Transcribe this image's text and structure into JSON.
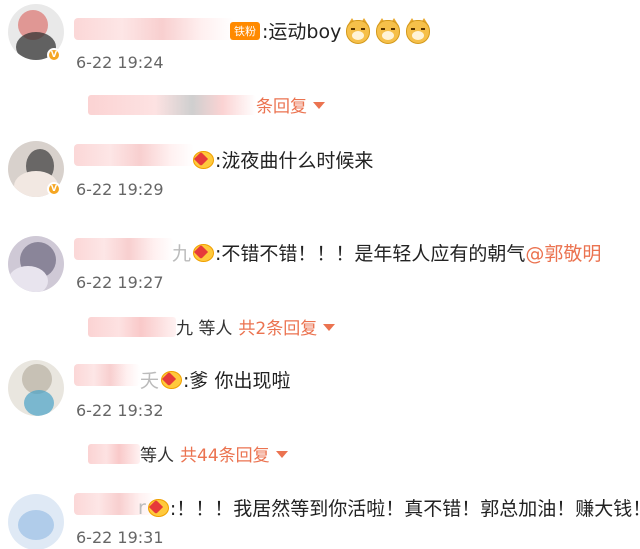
{
  "comments": [
    {
      "fan_badge": "铁粉",
      "text": ":运动boy",
      "emojis": [
        "doge-emoji",
        "doge-emoji",
        "doge-emoji"
      ],
      "time": "6-22 19:24",
      "reply_suffix": "条回复"
    },
    {
      "text": ":泷夜曲什么时候来",
      "time": "6-22 19:29"
    },
    {
      "name_tail": "九",
      "text": ":不错不错！！！是年轻人应有的朝气",
      "mention": "@郭敬明",
      "time": "6-22 19:27",
      "reply_prefix": "九 等人",
      "reply_count": "共2条回复"
    },
    {
      "name_tail": "夭",
      "text": ":爹 你出现啦",
      "time": "6-22 19:32",
      "reply_prefix": "等人",
      "reply_count": "共44条回复"
    },
    {
      "name_tail": "r",
      "text": ":！！！我居然等到你活啦！真不错！郭总加油！赚大钱！",
      "time": "6-22 19:31"
    }
  ],
  "colors": {
    "accent": "#eb7350",
    "time": "#666666"
  }
}
